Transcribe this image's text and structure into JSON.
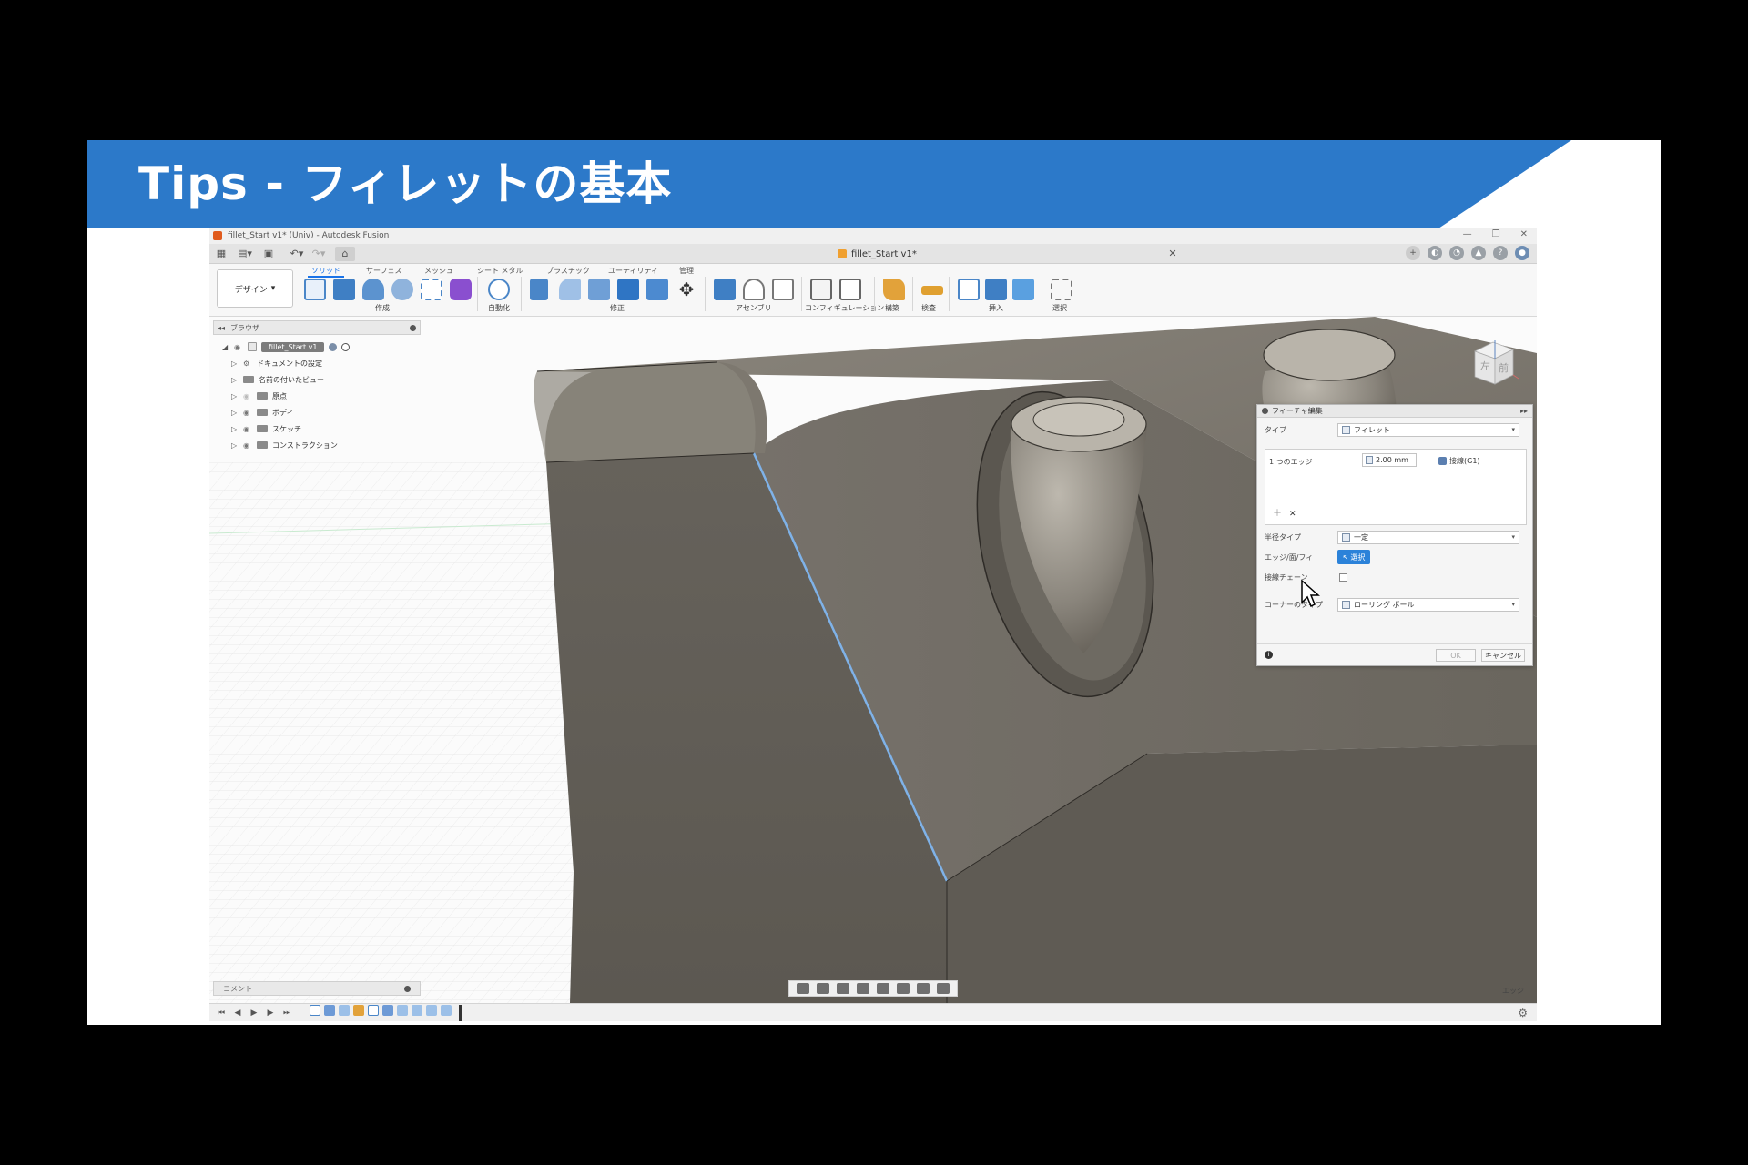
{
  "slide": {
    "title": "Tips - フィレットの基本"
  },
  "app": {
    "window_title": "fillet_Start v1* (Univ) - Autodesk Fusion",
    "document_tab": "fillet_Start v1*",
    "workspace": "デザイン",
    "ribbon_tabs": [
      "ソリッド",
      "サーフェス",
      "メッシュ",
      "シート メタル",
      "プラスチック",
      "ユーティリティ",
      "管理"
    ],
    "ribbon_groups": [
      "作成",
      "自動化",
      "修正",
      "アセンブリ",
      "コンフィギュレーション",
      "構築",
      "検査",
      "挿入",
      "選択"
    ]
  },
  "browser": {
    "title": "ブラウザ",
    "root": "fillet_Start v1",
    "items": [
      "ドキュメントの設定",
      "名前の付いたビュー",
      "原点",
      "ボディ",
      "スケッチ",
      "コンストラクション"
    ]
  },
  "viewcube": {
    "left": "左",
    "front": "前"
  },
  "dialog": {
    "title": "フィーチャ編集",
    "type_label": "タイプ",
    "type_value": "フィレット",
    "edge_label": "1 つのエッジ",
    "distance": "2.00 mm",
    "tangent": "接線(G1)",
    "radius_type_label": "半径タイプ",
    "radius_type_value": "一定",
    "edge_face_label": "エッジ/面/フィ",
    "select_button": "選択",
    "chain_label": "接線チェーン",
    "corner_type_label": "コーナーのタイプ",
    "corner_type_value": "ローリング ボール",
    "ok": "OK",
    "cancel": "キャンセル"
  },
  "comments": {
    "title": "コメント"
  },
  "status": {
    "text": "エッジ"
  },
  "colors": {
    "banner": "#2c79c9",
    "accent": "#1a73e8",
    "body": "#6d6960",
    "highlight": "#7fb2e8"
  }
}
